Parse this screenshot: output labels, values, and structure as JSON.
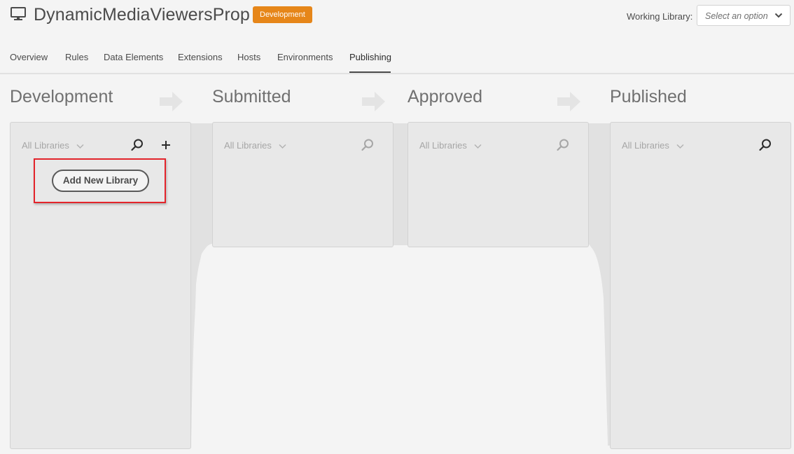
{
  "header": {
    "title": "DynamicMediaViewersProp",
    "environment_badge": "Development",
    "working_library": {
      "label": "Working Library:",
      "placeholder": "Select an option"
    }
  },
  "tabs": [
    {
      "label": "Overview"
    },
    {
      "label": "Rules"
    },
    {
      "label": "Data Elements"
    },
    {
      "label": "Extensions"
    },
    {
      "label": "Hosts"
    },
    {
      "label": "Environments"
    },
    {
      "label": "Publishing",
      "active": true
    }
  ],
  "stages": [
    {
      "title": "Development",
      "filter": "All Libraries",
      "search_active": true,
      "has_add": true
    },
    {
      "title": "Submitted",
      "filter": "All Libraries",
      "search_active": false
    },
    {
      "title": "Approved",
      "filter": "All Libraries",
      "search_active": false
    },
    {
      "title": "Published",
      "filter": "All Libraries",
      "search_active": true
    }
  ],
  "development": {
    "add_new_library_label": "Add New Library"
  },
  "colors": {
    "badge": "#e68619",
    "highlight": "#e3242b",
    "panel": "#e8e8e8"
  }
}
